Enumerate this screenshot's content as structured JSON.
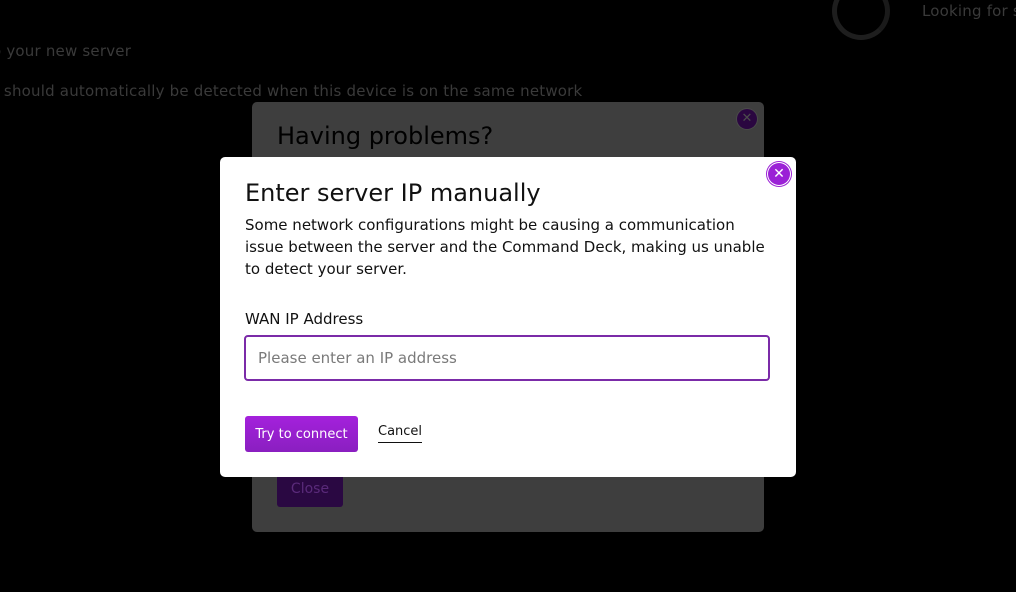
{
  "background": {
    "heading": "o your new server",
    "hint": ", should automatically be detected when this device is on the same network",
    "status": "Looking for se"
  },
  "problems_modal": {
    "title": "Having problems?",
    "close_icon": "close-icon",
    "close_label": "Close"
  },
  "manual_modal": {
    "title": "Enter server IP manually",
    "description": "Some network configurations might be causing a communication issue between the server and the Command Deck, making us unable to detect your server.",
    "field_label": "WAN IP Address",
    "input_value": "",
    "input_placeholder": "Please enter an IP address",
    "connect_label": "Try to connect",
    "cancel_label": "Cancel",
    "close_icon": "close-icon"
  },
  "colors": {
    "accent": "#9b21d6",
    "input_border": "#7b2ba8",
    "backdrop": "#000000"
  }
}
